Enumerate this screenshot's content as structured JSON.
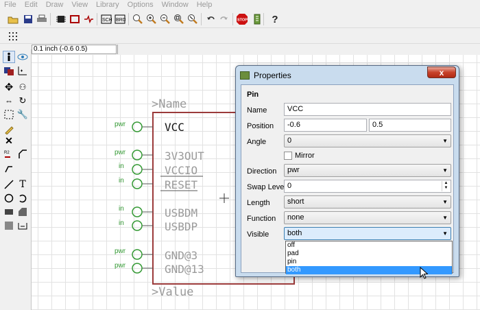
{
  "menu": [
    "File",
    "Edit",
    "Draw",
    "View",
    "Library",
    "Options",
    "Window",
    "Help"
  ],
  "toolbar_icons": [
    "open-icon",
    "save-icon",
    "print-icon",
    "chip-icon",
    "component-icon",
    "schematic-icon",
    "pcb-icon",
    "board-icon",
    "zoom-icon",
    "zoom-in-icon",
    "zoom-out-icon",
    "zoom-fit-icon",
    "zoom-select-icon",
    "undo-icon",
    "redo-icon",
    "stop-icon",
    "script-icon",
    "help-icon"
  ],
  "coord_readout": "0.1 inch (-0.6 0.5)",
  "schematic": {
    "name_label": ">Name",
    "value_label": ">Value",
    "pins": [
      {
        "name": "VCC",
        "dir": "pwr"
      },
      {
        "name": "3V3OUT",
        "dir": "pwr"
      },
      {
        "name": "VCCIO",
        "dir": "in"
      },
      {
        "name": "RESET",
        "dir": "in"
      },
      {
        "name": "USBDM",
        "dir": "in"
      },
      {
        "name": "USBDP",
        "dir": "in"
      },
      {
        "name": "GND@3",
        "dir": "pwr"
      },
      {
        "name": "GND@13",
        "dir": "pwr"
      }
    ]
  },
  "dialog": {
    "title": "Properties",
    "close": "x",
    "section": "Pin",
    "fields": {
      "name_label": "Name",
      "name_value": "VCC",
      "position_label": "Position",
      "position_x": "-0.6",
      "position_y": "0.5",
      "angle_label": "Angle",
      "angle_value": "0",
      "mirror_label": "Mirror",
      "direction_label": "Direction",
      "direction_value": "pwr",
      "swap_label": "Swap Level",
      "swap_value": "0",
      "length_label": "Length",
      "length_value": "short",
      "function_label": "Function",
      "function_value": "none",
      "visible_label": "Visible",
      "visible_value": "both"
    },
    "visible_options": [
      "off",
      "pad",
      "pin",
      "both"
    ]
  }
}
